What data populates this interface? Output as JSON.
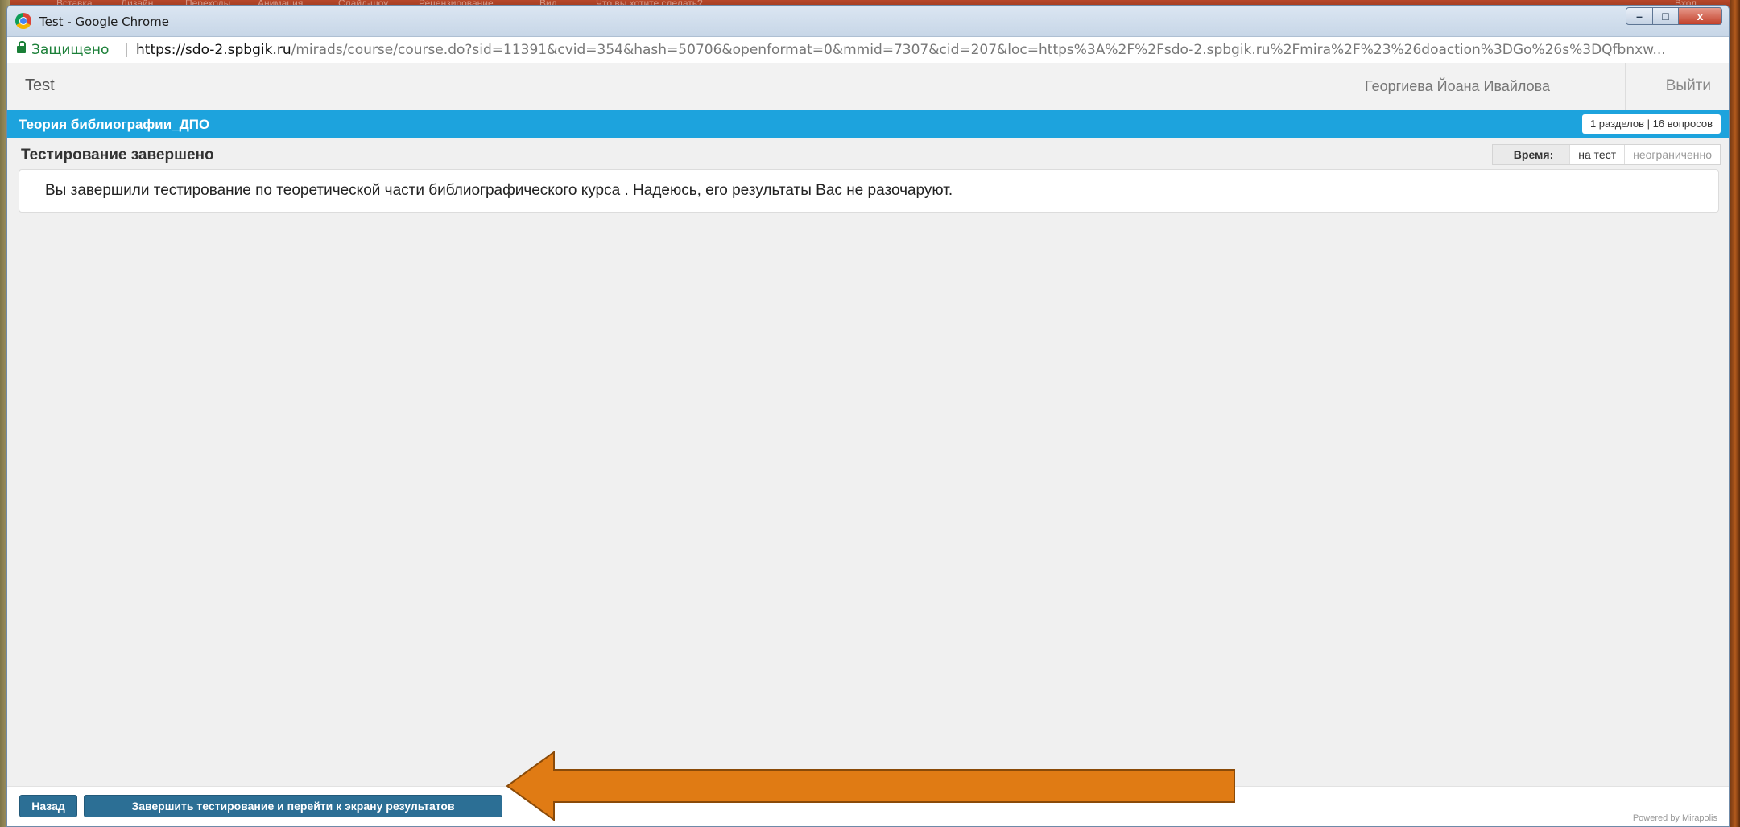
{
  "background_ribbon": [
    "Вставка",
    "Дизайн",
    "Переходы",
    "Анимация",
    "Слайд-шоу",
    "Рецензирование",
    "Вид",
    "Что вы хотите сделать?",
    "Вход"
  ],
  "window": {
    "title": "Test - Google Chrome",
    "controls": {
      "minimize": "–",
      "maximize": "□",
      "close": "x"
    }
  },
  "address": {
    "secure_label": "Защищено",
    "url_host": "https://sdo-2.spbgik.ru",
    "url_path": "/mirads/course/course.do?sid=11391&cvid=354&hash=50706&openformat=0&mmid=7307&cid=207&loc=https%3A%2F%2Fsdo-2.spbgik.ru%2Fmira%2F%23%26doaction%3DGo%26s%3DQfbnxw..."
  },
  "header": {
    "app_title": "Test",
    "user_name": "Георгиева Йоана Ивайлова",
    "logout_label": "Выйти"
  },
  "course": {
    "title": "Теория библиографии_ДПО",
    "summary": "1 разделов | 16 вопросов"
  },
  "status": {
    "title": "Тестирование завершено",
    "time_label": "Время:",
    "time_scope": "на тест",
    "time_value": "неограниченно"
  },
  "message": "Вы завершили тестирование по теоретической части библиографического курса . Надеюсь, его результаты Вас не разочаруют.",
  "footer": {
    "back_label": "Назад",
    "finish_label": "Завершить тестирование и перейти к экрану результатов",
    "powered": "Powered by Mirapolis"
  },
  "colors": {
    "course_bar": "#1da3dd",
    "button": "#2c6f95",
    "arrow": "#e07b14"
  }
}
